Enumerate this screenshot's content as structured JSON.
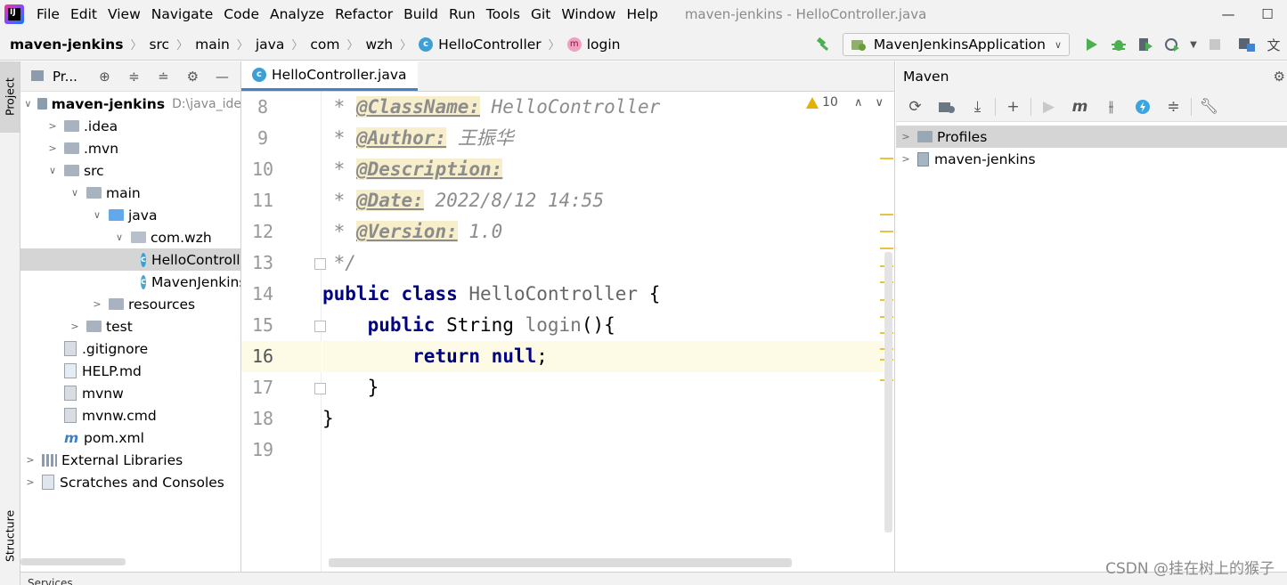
{
  "menubar": {
    "logo": "IJ",
    "items": [
      "File",
      "Edit",
      "View",
      "Navigate",
      "Code",
      "Analyze",
      "Refactor",
      "Build",
      "Run",
      "Tools",
      "Git",
      "Window",
      "Help"
    ],
    "window_title": "maven-jenkins - HelloController.java",
    "minimize_glyph": "—",
    "maximize_glyph": "☐"
  },
  "breadcrumb": {
    "project": "maven-jenkins",
    "segments": [
      "src",
      "main",
      "java",
      "com",
      "wzh"
    ],
    "class_badge": "c",
    "class_name": "HelloController",
    "method_badge": "m",
    "method_name": "login",
    "separator": "〉"
  },
  "run_toolbar": {
    "config_name": "MavenJenkinsApplication",
    "icons": [
      "hammer-icon",
      "run-icon",
      "debug-icon",
      "coverage-icon",
      "profiler-icon",
      "more-icon",
      "stop-icon",
      "project-structure-icon",
      "translate-icon"
    ]
  },
  "left_strip": {
    "project_tab": "Project",
    "structure_tab": "Structure"
  },
  "project_panel": {
    "title": "Pr...",
    "rows": [
      {
        "label": "maven-jenkins",
        "hint": "D:\\java_ide",
        "level": 0,
        "arrow": "v",
        "icon": "module"
      },
      {
        "label": ".idea",
        "level": 1,
        "arrow": ">",
        "icon": "folder"
      },
      {
        "label": ".mvn",
        "level": 1,
        "arrow": ">",
        "icon": "folder"
      },
      {
        "label": "src",
        "level": 1,
        "arrow": "v",
        "icon": "folder"
      },
      {
        "label": "main",
        "level": 2,
        "arrow": "v",
        "icon": "folder"
      },
      {
        "label": "java",
        "level": 3,
        "arrow": "v",
        "icon": "folder-blue"
      },
      {
        "label": "com.wzh",
        "level": 4,
        "arrow": "v",
        "icon": "package"
      },
      {
        "label": "HelloController",
        "level": 5,
        "arrow": "",
        "icon": "class",
        "selected": true
      },
      {
        "label": "MavenJenkinsApplication",
        "level": 5,
        "arrow": "",
        "icon": "spring-class"
      },
      {
        "label": "resources",
        "level": 3,
        "arrow": ">",
        "icon": "folder"
      },
      {
        "label": "test",
        "level": 2,
        "arrow": ">",
        "icon": "folder"
      },
      {
        "label": ".gitignore",
        "level": 1,
        "arrow": "",
        "icon": "file"
      },
      {
        "label": "HELP.md",
        "level": 1,
        "arrow": "",
        "icon": "md"
      },
      {
        "label": "mvnw",
        "level": 1,
        "arrow": "",
        "icon": "file"
      },
      {
        "label": "mvnw.cmd",
        "level": 1,
        "arrow": "",
        "icon": "file"
      },
      {
        "label": "pom.xml",
        "level": 1,
        "arrow": "",
        "icon": "maven"
      },
      {
        "label": "External Libraries",
        "level": 0,
        "arrow": ">",
        "icon": "libraries"
      },
      {
        "label": "Scratches and Consoles",
        "level": 0,
        "arrow": ">",
        "icon": "scratches"
      }
    ]
  },
  "editor": {
    "tab_label": "HelloController.java",
    "tab_badge": "c",
    "warnings_count": "10",
    "current_line": 16,
    "lines": [
      {
        "no": "8"
      },
      {
        "no": "9"
      },
      {
        "no": "10"
      },
      {
        "no": "11"
      },
      {
        "no": "12"
      },
      {
        "no": "13"
      },
      {
        "no": "14"
      },
      {
        "no": "15"
      },
      {
        "no": "16"
      },
      {
        "no": "17"
      },
      {
        "no": "18"
      },
      {
        "no": "19"
      }
    ],
    "code": {
      "l8_star": " * ",
      "l8_tag": "@ClassName:",
      "l8_val": " HelloController",
      "l9_star": " * ",
      "l9_tag": "@Author:",
      "l9_val": " 王振华",
      "l10_star": " * ",
      "l10_tag": "@Description:",
      "l11_star": " * ",
      "l11_tag": "@Date:",
      "l11_val": " 2022/8/12 14:55",
      "l12_star": " * ",
      "l12_tag": "@Version:",
      "l12_val": " 1.0",
      "l13": " */",
      "l14_kw1": "public",
      "l14_kw2": "class",
      "l14_name": "HelloController",
      "l14_brace": " {",
      "l15_kw": "public",
      "l15_type": "String",
      "l15_fn": "login",
      "l15_rest": "(){",
      "l16_kw": "return",
      "l16_val": "null",
      "l16_semi": ";",
      "l17": "}",
      "l18": "}"
    }
  },
  "maven_panel": {
    "title": "Maven",
    "tools": [
      "reload-icon",
      "generate-sources-icon",
      "download-icon",
      "add-icon",
      "run-maven-icon",
      "execute-goal-icon",
      "toggle-offline-icon",
      "skip-tests-icon",
      "collapse-icon",
      "settings-wrench-icon"
    ],
    "rows": [
      {
        "label": "Profiles",
        "selected": true
      },
      {
        "label": "maven-jenkins",
        "selected": false
      }
    ]
  },
  "bottom": {
    "label": "Services"
  },
  "watermark": "CSDN @挂在树上的猴子",
  "colors": {
    "accent": "#4083c9",
    "keyword": "#000080",
    "comment": "#8c8c8c",
    "warning": "#e5b000",
    "run_green": "#4caf50"
  }
}
